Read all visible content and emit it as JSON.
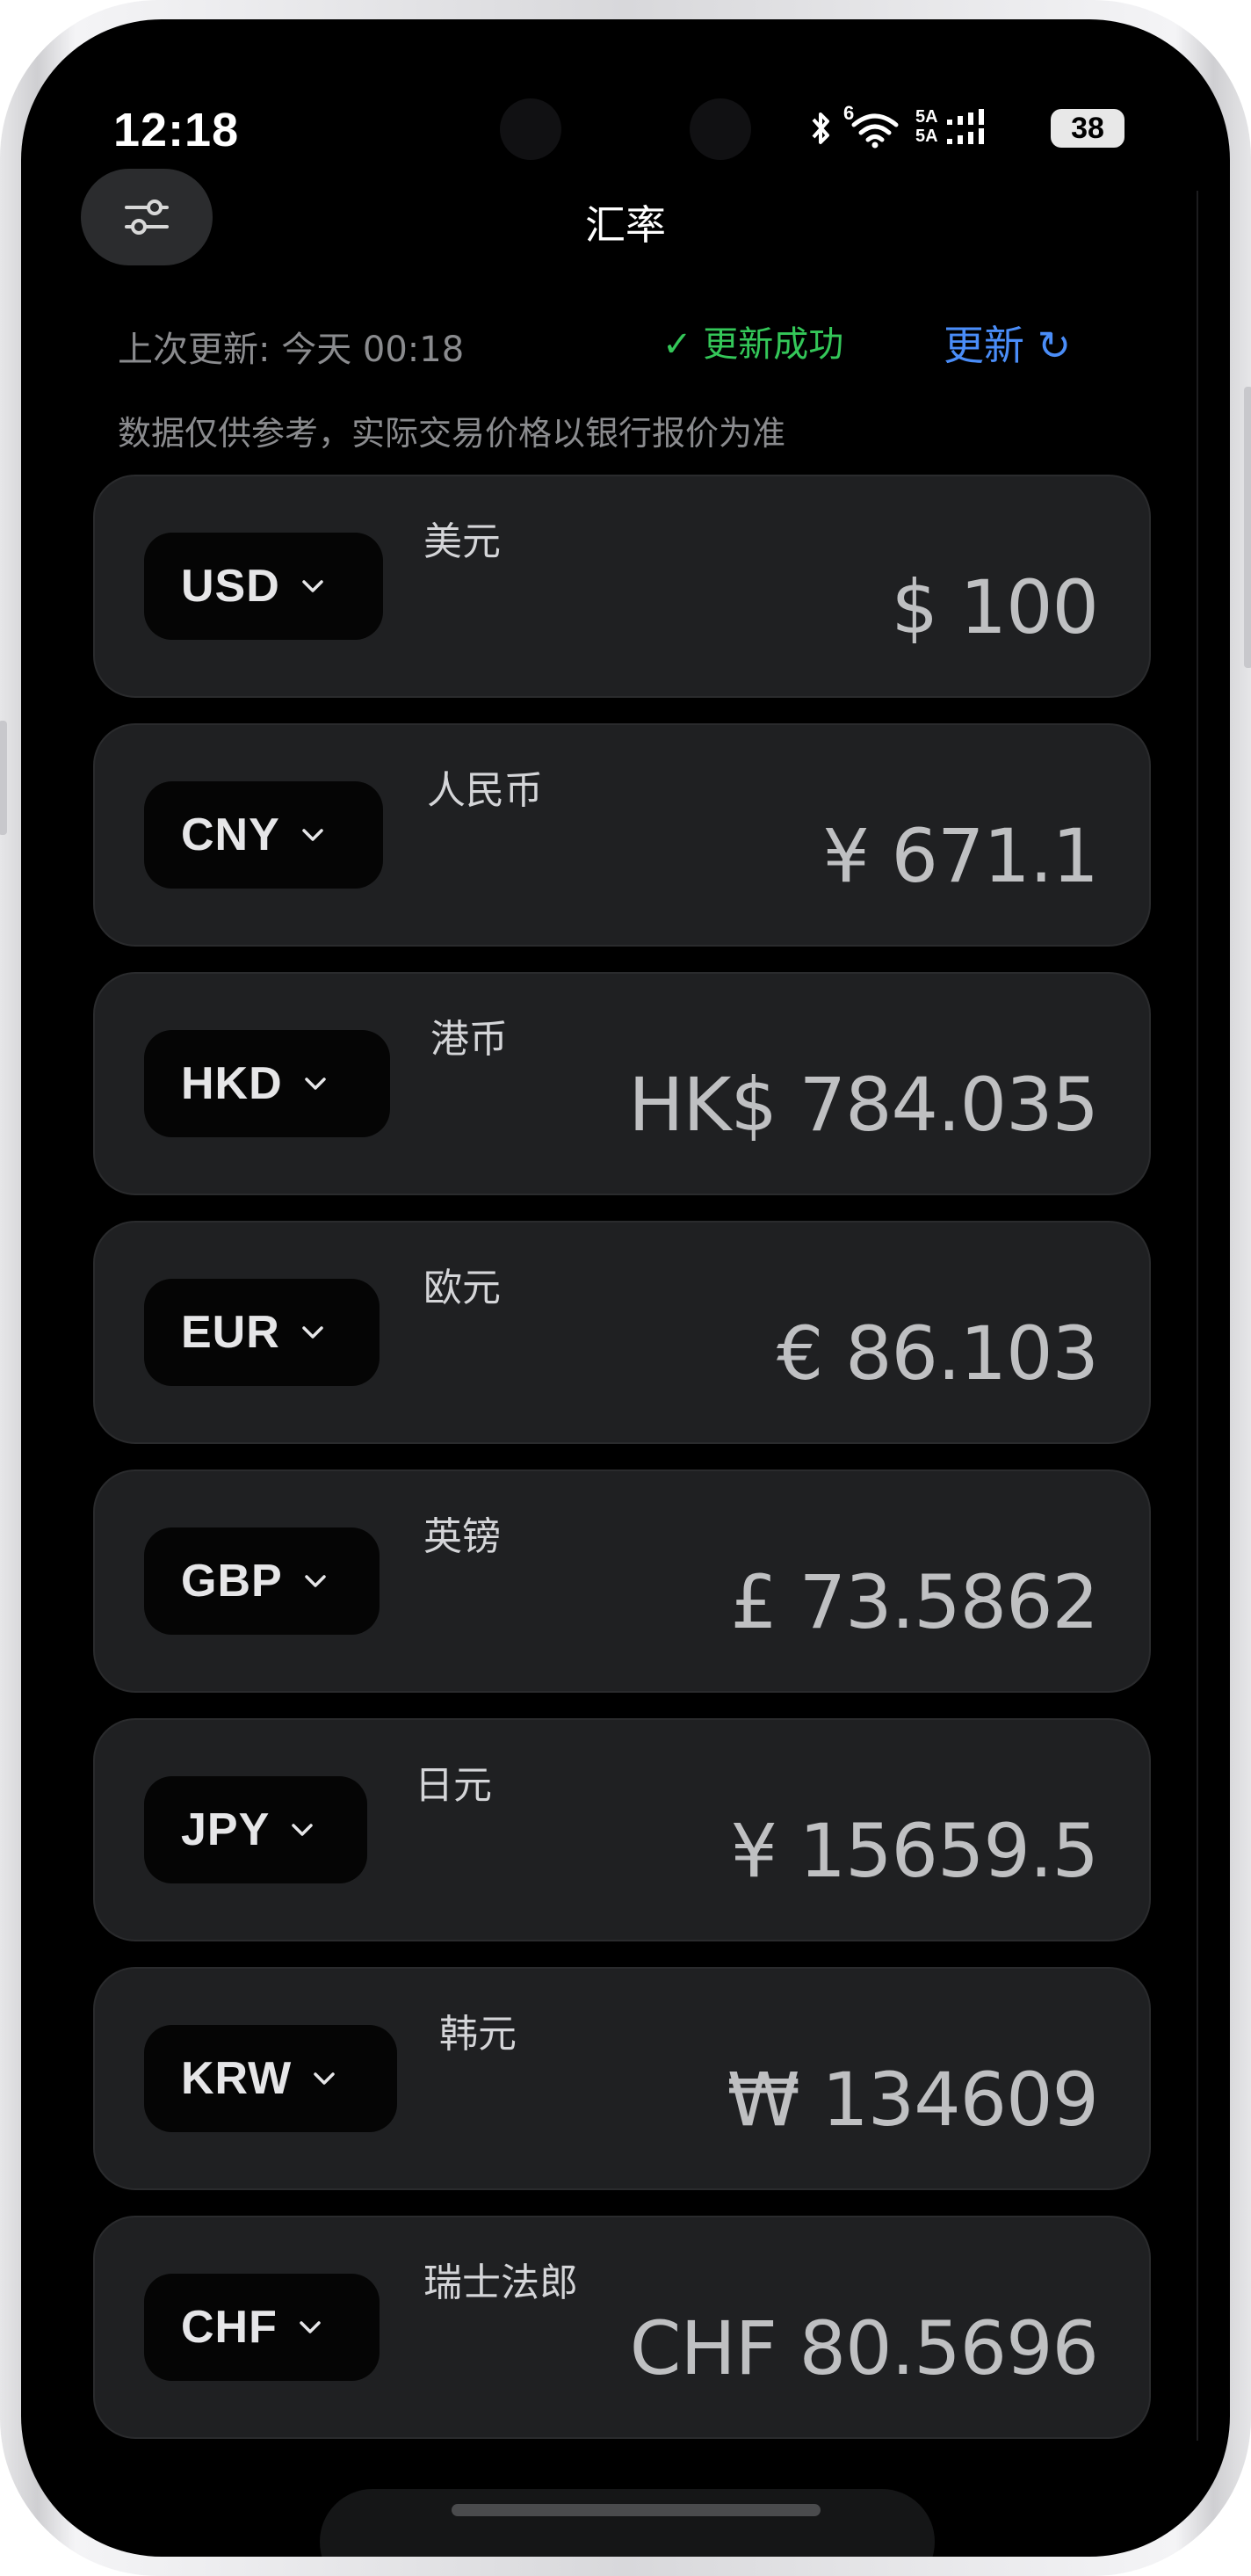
{
  "status_bar": {
    "time": "12:18",
    "battery": "38",
    "network_label": "5A",
    "wifi_badge": "6"
  },
  "header": {
    "title": "汇率"
  },
  "update_row": {
    "last_update": "上次更新: 今天 00:18",
    "success": "✓ 更新成功",
    "update_label": "更新 ↻"
  },
  "disclaimer": "数据仅供参考，实际交易价格以银行报价为准",
  "currencies": [
    {
      "code": "USD",
      "name": "美元",
      "value": "$ 100"
    },
    {
      "code": "CNY",
      "name": "人民币",
      "value": "¥ 671.1"
    },
    {
      "code": "HKD",
      "name": "港币",
      "value": "HK$ 784.035"
    },
    {
      "code": "EUR",
      "name": "欧元",
      "value": "€ 86.103"
    },
    {
      "code": "GBP",
      "name": "英镑",
      "value": "£ 73.5862"
    },
    {
      "code": "JPY",
      "name": "日元",
      "value": "¥ 15659.5"
    },
    {
      "code": "KRW",
      "name": "韩元",
      "value": "₩ 134609"
    },
    {
      "code": "CHF",
      "name": "瑞士法郎",
      "value": "CHF 80.5696"
    }
  ],
  "colors": {
    "background": "#000000",
    "card": "#1f2022",
    "accent_blue": "#4a8df8",
    "success_green": "#34c759"
  }
}
